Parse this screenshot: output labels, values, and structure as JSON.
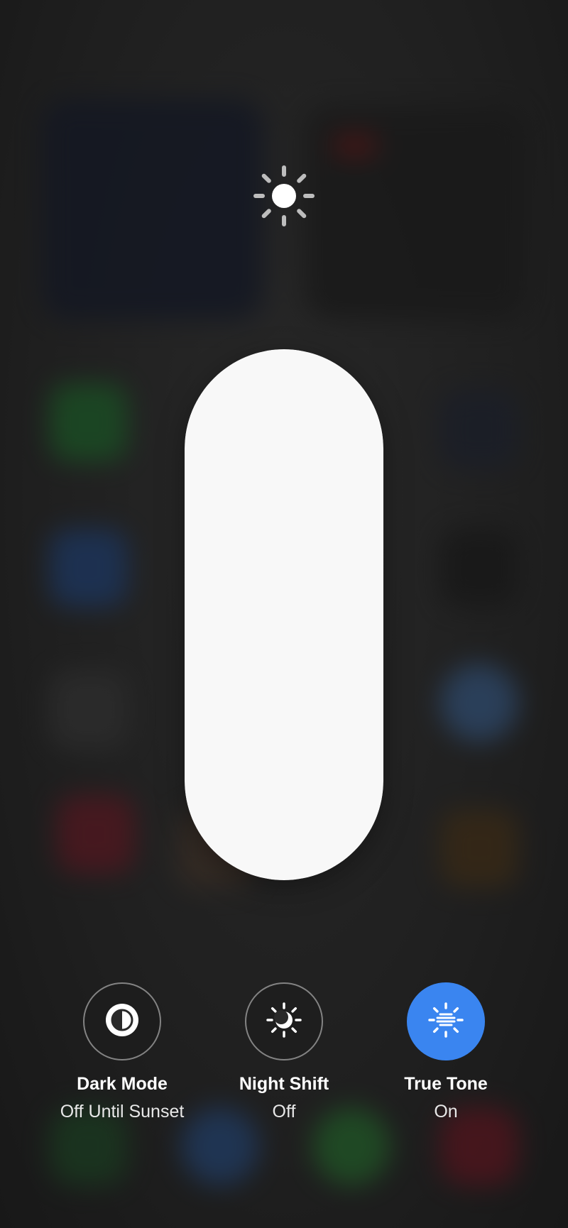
{
  "brightness": {
    "icon": "sun-max-icon",
    "level": 1.0
  },
  "toggles": [
    {
      "label": "Dark Mode",
      "status": "Off Until Sunset",
      "icon": "dark-mode-icon",
      "active": false
    },
    {
      "label": "Night Shift",
      "status": "Off",
      "icon": "night-shift-icon",
      "active": false
    },
    {
      "label": "True Tone",
      "status": "On",
      "icon": "true-tone-icon",
      "active": true
    }
  ],
  "colors": {
    "active_toggle": "#3a85f0",
    "slider_fill": "#f8f8f8",
    "background": "#2a2a2a"
  }
}
